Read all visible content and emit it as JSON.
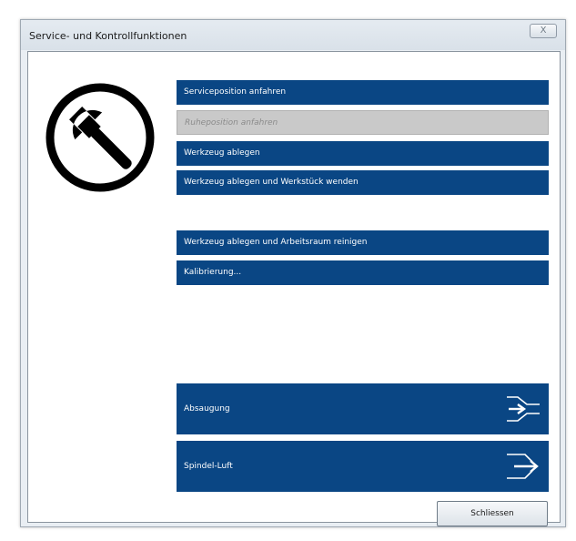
{
  "window": {
    "title": "Service- und Kontrollfunktionen",
    "close_symbol": "X"
  },
  "logo": {
    "icon": "wrench-icon"
  },
  "buttons": [
    {
      "label": "Serviceposition anfahren",
      "enabled": true
    },
    {
      "label": "Ruheposition anfahren",
      "enabled": false
    },
    {
      "label": "Werkzeug ablegen",
      "enabled": true
    },
    {
      "label": "Werkzeug ablegen und Werkstück wenden",
      "enabled": true
    },
    {
      "label": "Werkzeug ablegen und Arbeitsraum reinigen",
      "enabled": true
    },
    {
      "label": "Kalibrierung...",
      "enabled": true
    }
  ],
  "toggles": {
    "absaugung": {
      "label": "Absaugung",
      "icon": "suction-arrow-icon"
    },
    "spindel_luft": {
      "label": "Spindel-Luft",
      "icon": "air-arrow-icon"
    }
  },
  "footer": {
    "close_label": "Schliessen"
  },
  "colors": {
    "button_blue": "#0a4684",
    "button_disabled": "#c9c9c9",
    "window_frame": "#e9eef3"
  }
}
